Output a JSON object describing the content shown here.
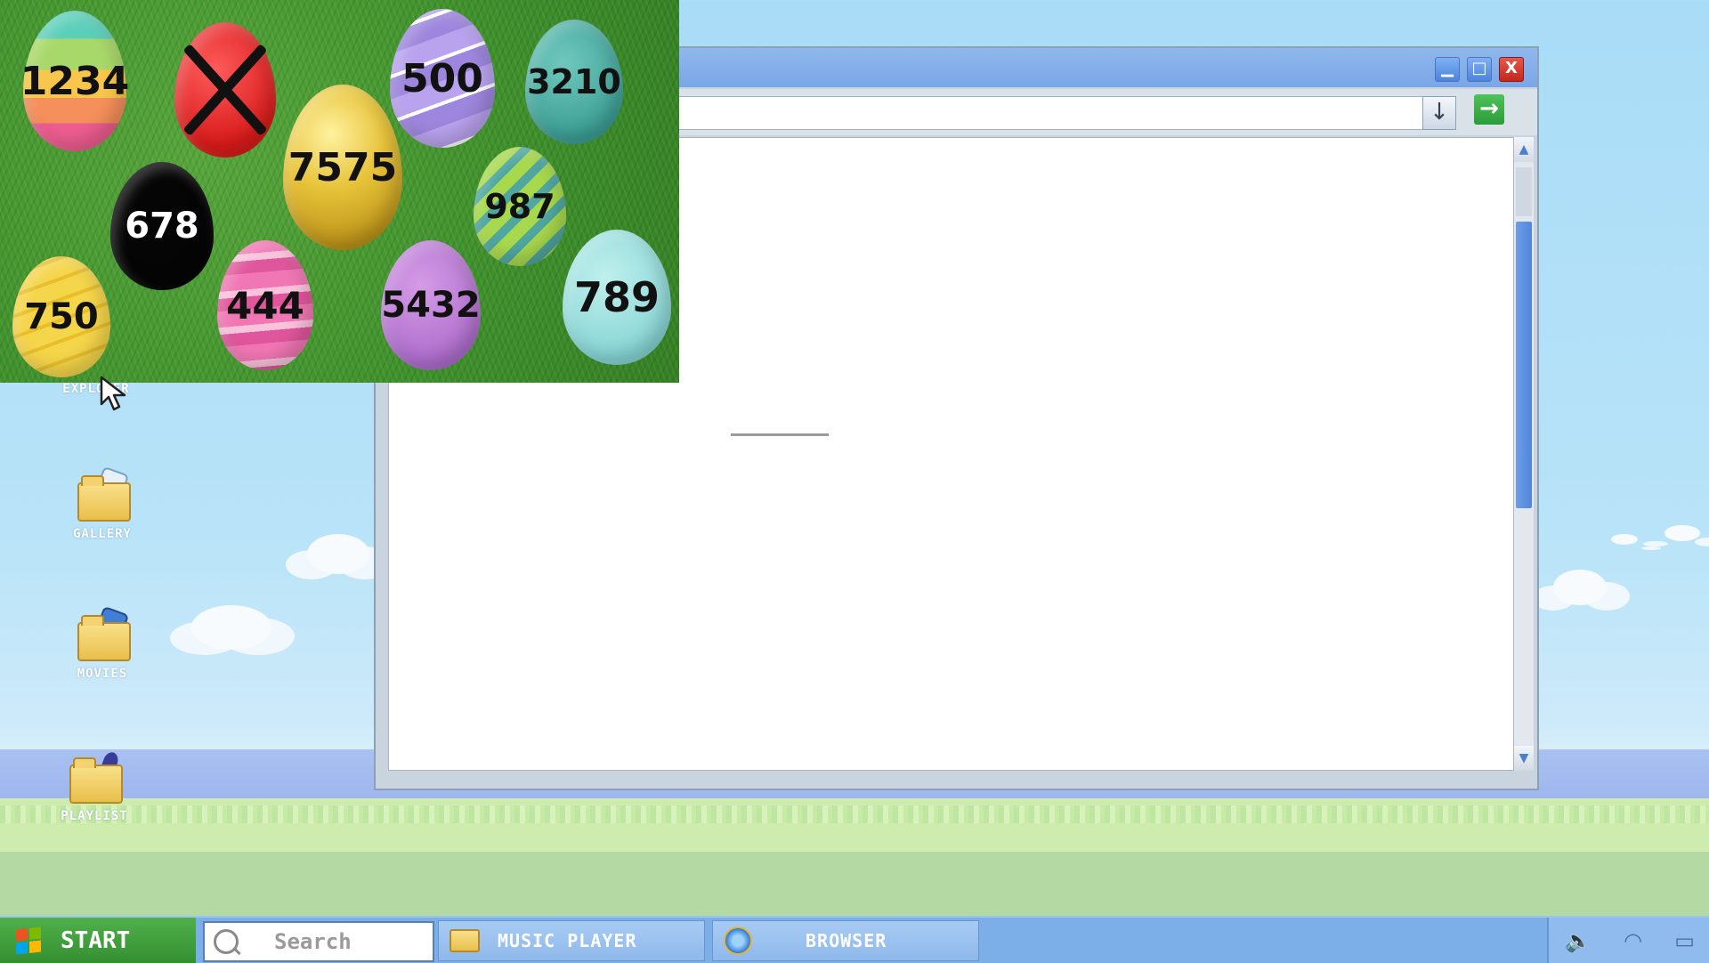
{
  "desktop": {
    "icons": [
      {
        "label": "INTERNET\nEXPLORER"
      },
      {
        "label": "GALLERY"
      },
      {
        "label": "MOVIES"
      },
      {
        "label": "PLAYLIST"
      }
    ]
  },
  "window": {
    "title": "",
    "address_value": "",
    "minimize_glyph": "▁",
    "maximize_glyph": "□",
    "close_glyph": "X",
    "dropdown_glyph": "↓",
    "go_glyph": "→"
  },
  "game": {
    "eggs": [
      {
        "value": "1234",
        "crossed": false,
        "style": "multicolor-zigzag"
      },
      {
        "value": "",
        "crossed": true,
        "style": "red"
      },
      {
        "value": "500",
        "crossed": false,
        "style": "purple-zigzag"
      },
      {
        "value": "3210",
        "crossed": false,
        "style": "teal-stars"
      },
      {
        "value": "7575",
        "crossed": false,
        "style": "gold"
      },
      {
        "value": "678",
        "crossed": false,
        "style": "black"
      },
      {
        "value": "987",
        "crossed": false,
        "style": "green-striped"
      },
      {
        "value": "750",
        "crossed": false,
        "style": "yellow-zigzag"
      },
      {
        "value": "444",
        "crossed": false,
        "style": "pink-striped"
      },
      {
        "value": "5432",
        "crossed": false,
        "style": "lilac-dotted"
      },
      {
        "value": "789",
        "crossed": false,
        "style": "aqua-dotted"
      }
    ]
  },
  "taskbar": {
    "start_label": "START",
    "search_placeholder": "Search",
    "tasks": [
      {
        "label": "MUSIC PLAYER",
        "icon": "music-folder-icon"
      },
      {
        "label": "BROWSER",
        "icon": "internet-explorer-icon"
      }
    ],
    "tray_icons": [
      "volume-icon",
      "wifi-icon",
      "notification-icon"
    ]
  },
  "colors": {
    "sky": "#a9dcf7",
    "taskbar": "#7caee8",
    "start": "#3f9f3a",
    "titlebar": "#7aa6e6",
    "close": "#c2281c"
  }
}
